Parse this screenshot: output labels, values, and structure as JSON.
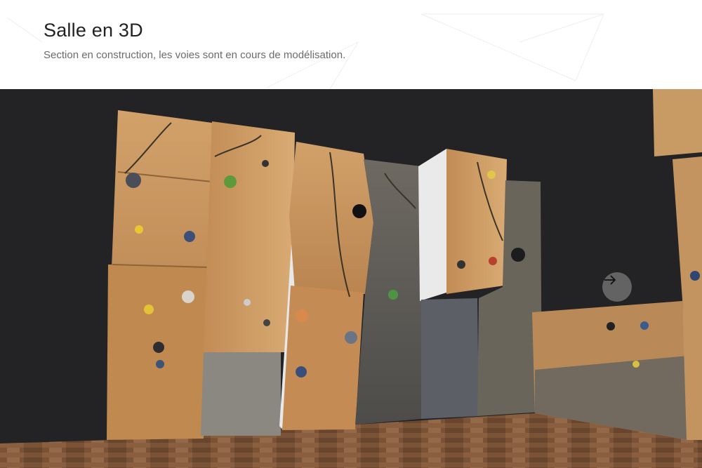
{
  "header": {
    "title": "Salle en 3D",
    "subtitle": "Section en construction, les voies sont en cours de modélisation."
  },
  "viewer": {
    "background_color": "#232326",
    "scene": "3d-climbing-wall-model",
    "next_button_icon": "arrow-right-icon"
  },
  "colors": {
    "plywood": "#c8975f",
    "floor": "#7a5236",
    "text_title": "#222222",
    "text_subtitle": "#6b6b6b"
  }
}
